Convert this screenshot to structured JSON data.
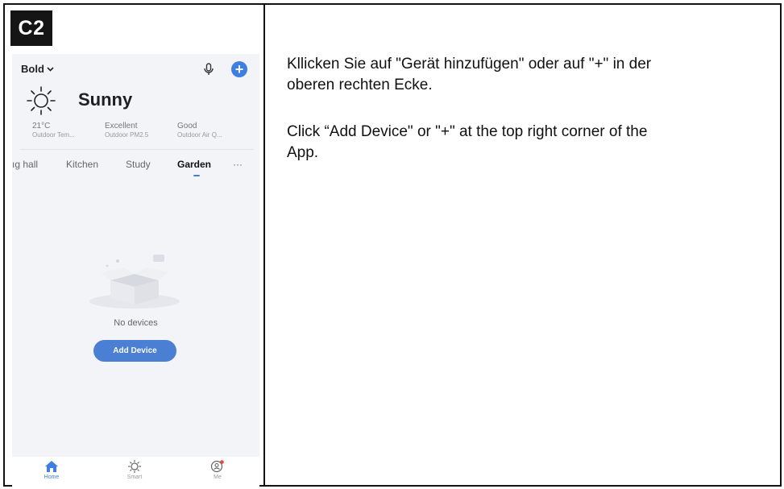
{
  "step": "C2",
  "app": {
    "home_name": "Bold",
    "weather": "Sunny",
    "stats": [
      {
        "value": "21°C",
        "label": "Outdoor Tem..."
      },
      {
        "value": "Excellent",
        "label": "Outdoor PM2.5"
      },
      {
        "value": "Good",
        "label": "Outdoor Air Q..."
      }
    ],
    "rooms": [
      "ıg hall",
      "Kitchen",
      "Study",
      "Garden",
      "···"
    ],
    "active_room": "Garden",
    "empty_text": "No devices",
    "add_device_label": "Add Device",
    "nav": [
      {
        "label": "Home",
        "icon": "home-icon"
      },
      {
        "label": "Smart",
        "icon": "sun-icon"
      },
      {
        "label": "Me",
        "icon": "profile-icon"
      }
    ],
    "accent_color": "#3f7fe0"
  },
  "instructions": {
    "de": "Kllicken Sie auf \"Gerät hinzufügen\" oder auf \"+\" in der oberen rechten Ecke.",
    "de_line1": "Kllicken Sie auf \"Gerät hinzufügen\" oder auf \"+\" in der",
    "de_line2": "oberen rechten Ecke.",
    "en_line1": "Click “Add Device\" or \"+\" at the top right corner of the",
    "en_line2": "App."
  }
}
